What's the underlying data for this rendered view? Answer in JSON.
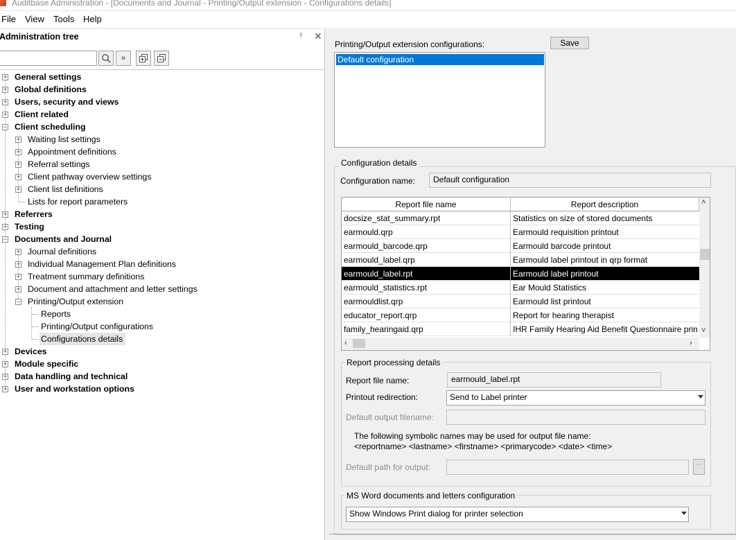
{
  "window": {
    "title": "Auditbase Administration - [Documents and Journal - Printing/Output extension - Configurations details]"
  },
  "menu": [
    "File",
    "View",
    "Tools",
    "Help"
  ],
  "left_panel": {
    "title": "Administration tree",
    "search_value": "",
    "tree": [
      {
        "label": "General settings",
        "bold": true
      },
      {
        "label": "Global definitions",
        "bold": true
      },
      {
        "label": "Users, security and views",
        "bold": true
      },
      {
        "label": "Client related",
        "bold": true
      },
      {
        "label": "Client scheduling",
        "bold": true
      },
      {
        "label": "Waiting list settings",
        "bold": false
      },
      {
        "label": "Appointment definitions",
        "bold": false
      },
      {
        "label": "Referral settings",
        "bold": false
      },
      {
        "label": "Client pathway overview settings",
        "bold": false
      },
      {
        "label": "Client list definitions",
        "bold": false
      },
      {
        "label": "Lists for report parameters",
        "bold": false
      },
      {
        "label": "Referrers",
        "bold": true
      },
      {
        "label": "Testing",
        "bold": true
      },
      {
        "label": "Documents and Journal",
        "bold": true
      },
      {
        "label": "Journal definitions",
        "bold": false
      },
      {
        "label": "Individual Management Plan definitions",
        "bold": false
      },
      {
        "label": "Treatment summary definitions",
        "bold": false
      },
      {
        "label": "Document and attachment and letter settings",
        "bold": false
      },
      {
        "label": "Printing/Output extension",
        "bold": false
      },
      {
        "label": "Reports",
        "bold": false
      },
      {
        "label": "Printing/Output configurations",
        "bold": false
      },
      {
        "label": "Configurations details",
        "bold": false
      },
      {
        "label": "Devices",
        "bold": true
      },
      {
        "label": "Module specific",
        "bold": true
      },
      {
        "label": "Data handling and technical",
        "bold": true
      },
      {
        "label": "User and workstation options",
        "bold": true
      }
    ]
  },
  "right_panel": {
    "config_list_label": "Printing/Output extension configurations:",
    "save_label": "Save",
    "config_list": [
      "Default configuration"
    ],
    "details": {
      "group_title": "Configuration details",
      "config_name_label": "Configuration name:",
      "config_name_value": "Default configuration",
      "grid": {
        "columns": [
          "Report file name",
          "Report description"
        ],
        "rows": [
          [
            "docsize_stat_summary.rpt",
            "Statistics on size of stored documents"
          ],
          [
            "earmould.qrp",
            "Earmould requisition printout"
          ],
          [
            "earmould_barcode.qrp",
            "Earmould barcode printout"
          ],
          [
            "earmould_label.qrp",
            "Earmould label printout in qrp format"
          ],
          [
            "earmould_label.rpt",
            "Earmould label printout"
          ],
          [
            "earmould_statistics.rpt",
            "Ear Mould Statistics"
          ],
          [
            "earmouldlist.qrp",
            "Earmould list printout"
          ],
          [
            "educator_report.qrp",
            "Report for hearing therapist"
          ],
          [
            "family_hearingaid.qrp",
            "IHR Family Hearing Aid Benefit Questionnaire prin"
          ]
        ],
        "selected_row": 4
      },
      "processing": {
        "group_title": "Report processing details",
        "report_file_label": "Report file name:",
        "report_file_value": "earmould_label.rpt",
        "redirection_label": "Printout redirection:",
        "redirection_value": "Send to Label printer",
        "default_output_label": "Default output filename:",
        "default_output_value": "",
        "symbolic_line1": "The following symbolic names may be used for output file name:",
        "symbolic_line2": "<reportname> <lastname> <firstname> <primarycode> <date> <time>",
        "default_path_label": "Default path for output:",
        "default_path_value": "",
        "browse_label": "..."
      },
      "msword": {
        "group_title": "MS Word documents and letters configuration",
        "value": "Show Windows Print dialog for printer selection"
      }
    }
  }
}
